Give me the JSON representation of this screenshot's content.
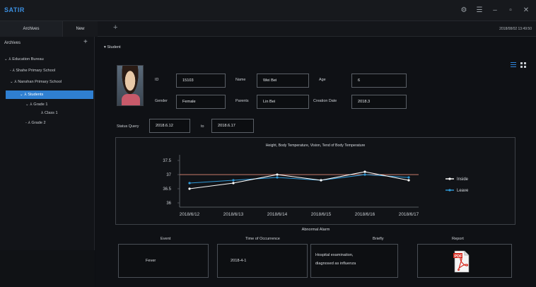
{
  "app": {
    "logo": "SATIR",
    "datetime": "2018/08/02 13:49:50"
  },
  "tabs": [
    {
      "label": "Archives"
    },
    {
      "label": "New"
    }
  ],
  "sidebar": {
    "header": "Archives",
    "tree": [
      {
        "label": "Education Bureau"
      },
      {
        "label": "Shahe Primary School"
      },
      {
        "label": "Nanshan Primary School"
      },
      {
        "label": "Students"
      },
      {
        "label": "Grade 1"
      },
      {
        "label": "Class 1"
      },
      {
        "label": "Grade 2"
      }
    ]
  },
  "main": {
    "breadcrumb": "Student",
    "profile": {
      "id_label": "ID",
      "id_value": "15103",
      "name_label": "Name",
      "name_value": "Wei Bei",
      "age_label": "Age",
      "age_value": "6",
      "gender_label": "Gender",
      "gender_value": "Female",
      "parents_label": "Parents",
      "parents_value": "Lin Bei",
      "creation_label": "Creation Date",
      "creation_value": "2018.3"
    },
    "status_query": {
      "label": "Status Query",
      "from": "2018.6.12",
      "to_label": "to",
      "to": "2018.6.17"
    },
    "alarm": {
      "title": "Abnormal Alarm",
      "headers": [
        "Event",
        "Time of Occurrence",
        "Briefly",
        "Report"
      ],
      "event": "Fever",
      "time": "2018-4-1",
      "brief_line1": "Hospital examination,",
      "brief_line2": "diagnosed as influenza"
    }
  },
  "chart_data": {
    "type": "line",
    "title": "Height, Body Temperature, Vision, Tend of Body Temperature",
    "categories": [
      "2018/6/12",
      "2018/6/13",
      "2018/6/14",
      "2018/6/15",
      "2018/6/16",
      "2018/6/17"
    ],
    "series": [
      {
        "name": "Inside",
        "values": [
          36.5,
          36.7,
          37.0,
          36.8,
          37.1,
          36.8
        ],
        "color": "#ffffff"
      },
      {
        "name": "Leave",
        "values": [
          36.7,
          36.8,
          36.9,
          36.8,
          37.0,
          36.9
        ],
        "color": "#2f9ad8"
      }
    ],
    "yticks": [
      37.5,
      37,
      36.5,
      36
    ],
    "ylim": [
      35.9,
      37.6
    ],
    "threshold": 37,
    "threshold_color": "#c77a6a",
    "legend_position": "right",
    "grid": false
  }
}
